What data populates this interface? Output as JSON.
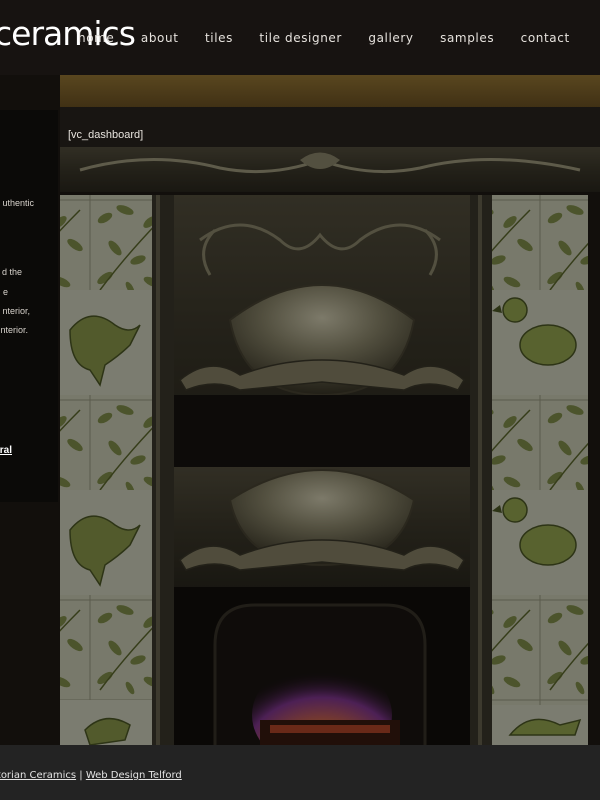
{
  "header": {
    "logo_text": "ceramics",
    "nav": [
      {
        "label": "home"
      },
      {
        "label": "about"
      },
      {
        "label": "tiles"
      },
      {
        "label": "tile designer"
      },
      {
        "label": "gallery"
      },
      {
        "label": "samples"
      },
      {
        "label": "contact"
      }
    ]
  },
  "main": {
    "shortcode_text": "[vc_dashboard]"
  },
  "sidebar": {
    "fragments": [
      {
        "text": "uthentic"
      },
      {
        "text": "d the"
      },
      {
        "text": "e"
      },
      {
        "text": "nterior,"
      },
      {
        "text": "nterior."
      },
      {
        "text": "ral"
      }
    ]
  },
  "footer": {
    "link_company": "Victorian Ceramics",
    "separator": "|",
    "link_webdesign": "Web Design Telford"
  },
  "colors": {
    "header_bg": "#161310",
    "footer_bg": "#232323",
    "tile_green": "#8a9a4a",
    "metal": "#8f8a6e"
  },
  "icons": {
    "decor": "fireplace-background-image"
  }
}
